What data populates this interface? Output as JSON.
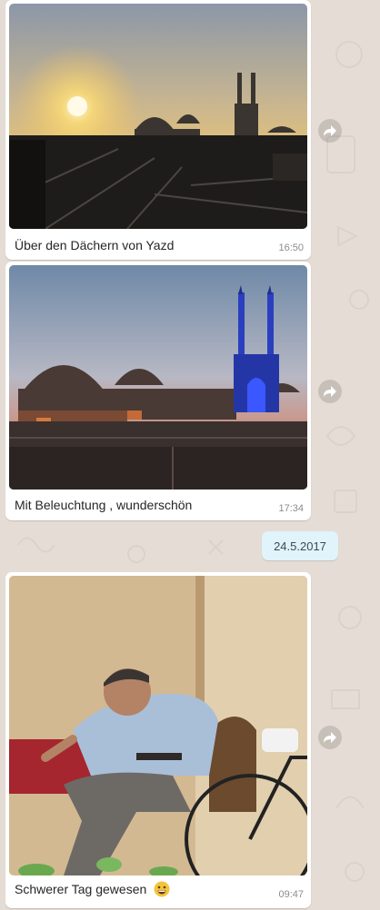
{
  "chat": {
    "messages": [
      {
        "caption": "Über den Dächern von Yazd",
        "time": "16:50"
      },
      {
        "caption": "Mit Beleuchtung , wunderschön",
        "time": "17:34"
      },
      {
        "caption": "Schwerer Tag gewesen",
        "emoji": "grinning-face",
        "time": "09:47"
      }
    ],
    "date_separator": "24.5.2017"
  },
  "colors": {
    "background": "#e5ddd5",
    "bubble": "#ffffff",
    "date_chip": "#e1f3fb",
    "timestamp": "#8c8c8c"
  },
  "icons": {
    "forward": "forward-arrow-icon",
    "emoji": "grinning-face-emoji"
  }
}
